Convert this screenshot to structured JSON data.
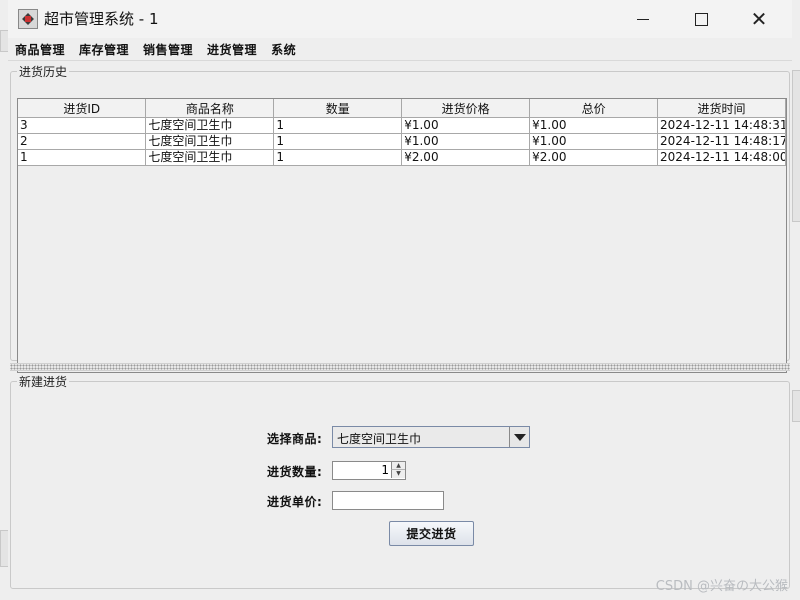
{
  "window": {
    "title": "超市管理系统 - 1"
  },
  "menu": [
    "商品管理",
    "库存管理",
    "销售管理",
    "进货管理",
    "系统"
  ],
  "history": {
    "legend": "进货历史",
    "columns": [
      "进货ID",
      "商品名称",
      "数量",
      "进货价格",
      "总价",
      "进货时间"
    ],
    "rows": [
      [
        "3",
        "七度空间卫生巾",
        "1",
        "¥1.00",
        "¥1.00",
        "2024-12-11 14:48:31"
      ],
      [
        "2",
        "七度空间卫生巾",
        "1",
        "¥1.00",
        "¥1.00",
        "2024-12-11 14:48:17"
      ],
      [
        "1",
        "七度空间卫生巾",
        "1",
        "¥2.00",
        "¥2.00",
        "2024-12-11 14:48:00"
      ]
    ]
  },
  "new_purchase": {
    "legend": "新建进货",
    "product_label": "选择商品:",
    "product_value": "七度空间卫生巾",
    "quantity_label": "进货数量:",
    "quantity_value": "1",
    "price_label": "进货单价:",
    "price_value": "",
    "submit_label": "提交进货"
  },
  "watermark": "CSDN @兴奋の大公猴"
}
